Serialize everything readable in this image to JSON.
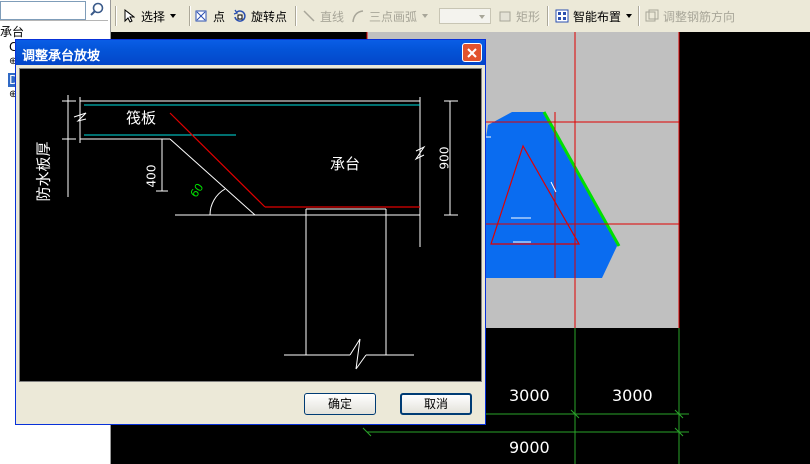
{
  "left_panel": {
    "search_placeholder": "",
    "tree": [
      "承台",
      "C",
      "⊕",
      "D",
      "⊕"
    ]
  },
  "toolbar": {
    "select_label": "选择",
    "point_label": "点",
    "rotate_point_label": "旋转点",
    "line_label": "直线",
    "three_point_arc_label": "三点画弧",
    "rect_label": "矩形",
    "smart_layout_label": "智能布置",
    "adjust_rebar_dir_label": "调整钢筋方向"
  },
  "canvas": {
    "dim_labels": [
      "3000",
      "3000",
      "9000"
    ],
    "colors": {
      "slab_fill": "#c0c0c0",
      "footing_fill": "#0a6cf0",
      "axis_red": "#e00000",
      "dim_green": "#2aa52a",
      "edge_green": "#00e000"
    }
  },
  "dialog": {
    "title": "调整承台放坡",
    "labels": {
      "raft": "筏板",
      "waterproof_thickness": "防水板厚",
      "cap": "承台",
      "dim_400": "400",
      "dim_900": "900",
      "angle_60": "60"
    },
    "ok_label": "确定",
    "cancel_label": "取消"
  }
}
